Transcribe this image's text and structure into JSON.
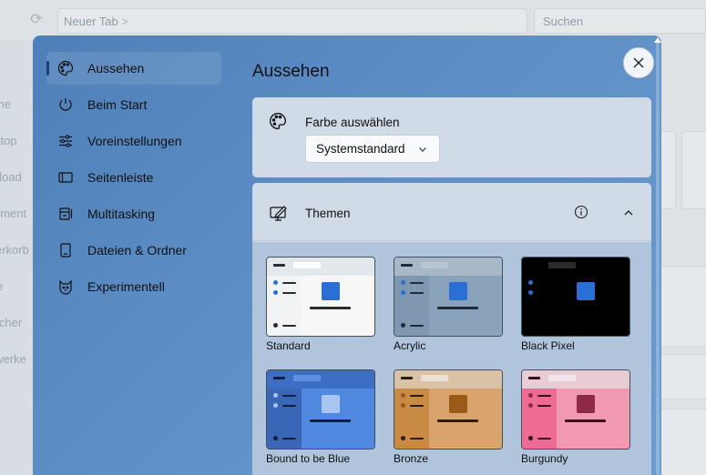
{
  "background": {
    "address_text": "Neuer Tab",
    "address_separator": ">",
    "search_placeholder": "Suchen",
    "sidebar_fragments": [
      "me",
      "ktop",
      "nload",
      "ument",
      "erkorb",
      "e",
      "icher",
      "werke"
    ]
  },
  "dialog": {
    "nav": {
      "items": [
        {
          "label": "Aussehen",
          "icon": "palette-icon",
          "active": true
        },
        {
          "label": "Beim Start",
          "icon": "power-icon",
          "active": false
        },
        {
          "label": "Voreinstellungen",
          "icon": "sliders-icon",
          "active": false
        },
        {
          "label": "Seitenleiste",
          "icon": "sidebar-icon",
          "active": false
        },
        {
          "label": "Multitasking",
          "icon": "multitasking-icon",
          "active": false
        },
        {
          "label": "Dateien & Ordner",
          "icon": "file-icon",
          "active": false
        },
        {
          "label": "Experimentell",
          "icon": "cat-icon",
          "active": false
        }
      ]
    },
    "content": {
      "title": "Aussehen",
      "color_section": {
        "label": "Farbe auswählen",
        "icon": "palette-icon",
        "selected": "Systemstandard"
      },
      "themes_section": {
        "label": "Themen",
        "icon": "theme-brush-icon",
        "expanded": true,
        "themes": [
          {
            "name": "Standard",
            "top": "#e3e8ed",
            "left": "#f1f3f5",
            "main": "#f7f7f7",
            "tab": "#ffffff",
            "dash": "#2b2b2b",
            "dot": "#2a6fd6",
            "line": "#2b2b2b",
            "square": "#2a6fd6",
            "bar": "#2b2b2b"
          },
          {
            "name": "Acrylic",
            "top": "#a9b8c8",
            "left": "#7f97b0",
            "main": "#8aa2ba",
            "tab": "#b8c6d4",
            "dash": "#1f2b38",
            "dot": "#2a6fd6",
            "line": "#1f2b38",
            "square": "#2a6fd6",
            "bar": "#1f2b38"
          },
          {
            "name": "Black Pixel",
            "top": "#000000",
            "left": "#000000",
            "main": "#000000",
            "tab": "#2b2b2b",
            "dash": "#000000",
            "dot": "#2a6fd6",
            "line": "#000000",
            "square": "#2a6fd6",
            "bar": "#000000"
          },
          {
            "name": "Bound to be Blue",
            "top": "#3d6ec4",
            "left": "#3a66b8",
            "main": "#5289e0",
            "tab": "#5d8fe0",
            "dash": "#0f1f3a",
            "dot": "#a9c6f2",
            "line": "#0f1f3a",
            "square": "#a9c6f2",
            "bar": "#0f1f3a"
          },
          {
            "name": "Bronze",
            "top": "#d9c2a6",
            "left": "#c98a44",
            "main": "#d8a36c",
            "tab": "#ece0d2",
            "dash": "#2b1c0f",
            "dot": "#9c5a18",
            "line": "#2b1c0f",
            "square": "#9c5a18",
            "bar": "#2b1c0f"
          },
          {
            "name": "Burgundy",
            "top": "#e7ccd6",
            "left": "#f06b93",
            "main": "#f29ab2",
            "tab": "#f3e3ea",
            "dash": "#3a0f1c",
            "dot": "#8c2a47",
            "line": "#3a0f1c",
            "square": "#8c2a47",
            "bar": "#3a0f1c"
          }
        ]
      }
    },
    "close_label": "×"
  }
}
